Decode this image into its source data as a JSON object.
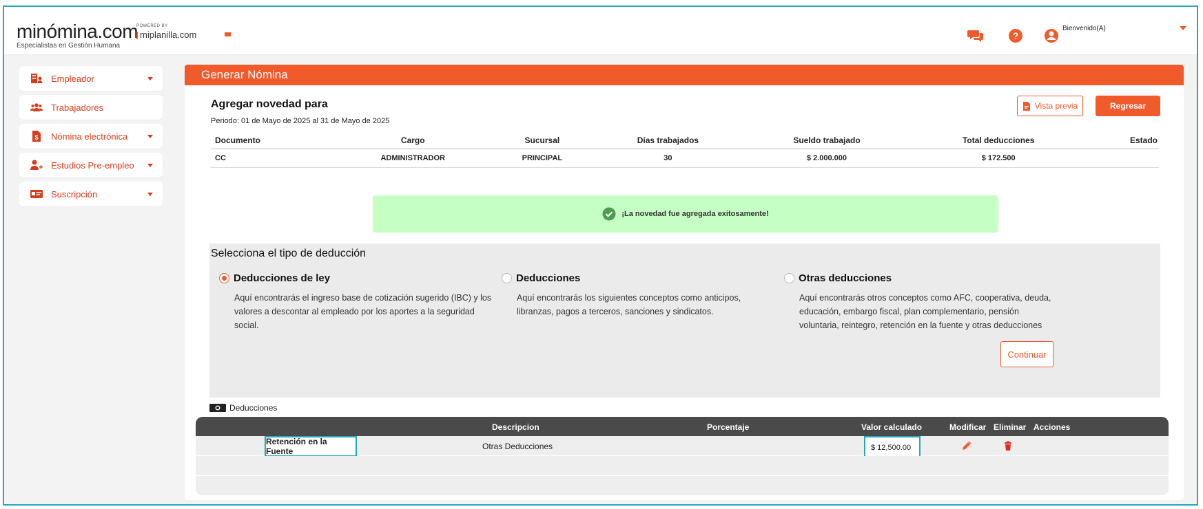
{
  "header": {
    "logo_main": "minómina.com",
    "logo_sub": "Especialistas en Gestión Humana",
    "powered_label": "POWERED BY",
    "powered_brand": "miplanilla.com",
    "welcome": "Bienvenido(A)"
  },
  "sidebar": {
    "items": [
      {
        "label": "Empleador",
        "icon": "building-user-icon"
      },
      {
        "label": "Trabajadores",
        "icon": "users-icon"
      },
      {
        "label": "Nómina electrónica",
        "icon": "document-dollar-icon"
      },
      {
        "label": "Estudios Pre-empleo",
        "icon": "user-plus-icon"
      },
      {
        "label": "Suscripción",
        "icon": "id-card-icon"
      }
    ]
  },
  "main": {
    "banner": "Generar Nómina",
    "title": "Agregar novedad para",
    "periodo": "Periodo: 01 de Mayo de 2025 al 31 de Mayo de 2025",
    "preview_label": "Vista previa",
    "back_label": "Regresar",
    "table": {
      "headers": [
        "Documento",
        "Cargo",
        "Sucursal",
        "Días trabajados",
        "Sueldo trabajado",
        "Total deducciones",
        "Estado"
      ],
      "row": [
        "CC",
        "ADMINISTRADOR",
        "PRINCIPAL",
        "30",
        "$ 2.000.000",
        "$ 172.500",
        ""
      ]
    },
    "success_msg": "¡La novedad fue agregada exitosamente!",
    "deduction_select": {
      "title": "Selecciona el tipo de deducción",
      "options": [
        {
          "label": "Deducciones de ley",
          "selected": true,
          "desc": "Aquí encontrarás el ingreso base de cotización sugerido (IBC) y los valores a descontar al empleado por los aportes a la seguridad social."
        },
        {
          "label": "Deducciones",
          "selected": false,
          "desc": "Aquí encontrarás los siguientes conceptos como anticipos, libranzas, pagos a terceros, sanciones y sindicatos."
        },
        {
          "label": "Otras deducciones",
          "selected": false,
          "desc": "Aquí encontrarás otros conceptos como AFC, cooperativa, deuda, educación, embargo fiscal, plan complementario, pensión voluntaria, reintegro, retención en la fuente y otras deducciones"
        }
      ],
      "continue_label": "Continuar"
    },
    "deductions_tag": "Deducciones",
    "deductions_table": {
      "headers": [
        "Descripcion",
        "Porcentaje",
        "Valor calculado",
        "Modificar",
        "Eliminar",
        "Acciones"
      ],
      "rows": [
        {
          "name": "Retención en la Fuente",
          "descripcion": "Otras Deducciones",
          "porcentaje": "",
          "valor": "$ 12,500.00"
        }
      ]
    }
  },
  "colors": {
    "accent": "#f15a2b",
    "highlight": "#23a9b8",
    "success_bg": "#c5ffc3",
    "table_head": "#4a4a4a"
  }
}
